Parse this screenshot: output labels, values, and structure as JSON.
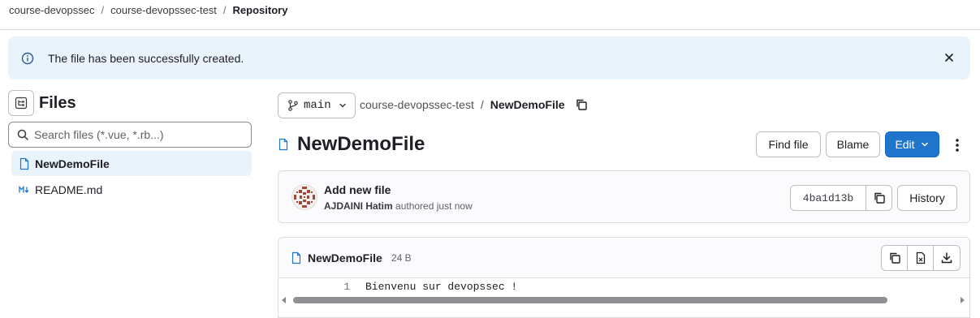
{
  "breadcrumb": {
    "items": [
      "course-devopssec",
      "course-devopssec-test"
    ],
    "current": "Repository",
    "separator": "/"
  },
  "alert": {
    "message": "The file has been successfully created.",
    "icon": "info-icon",
    "color": "#e9f3fc"
  },
  "sidebar": {
    "title": "Files",
    "search_placeholder": "Search files (*.vue, *.rb...)",
    "items": [
      {
        "label": "NewDemoFile",
        "icon": "file-icon",
        "active": true
      },
      {
        "label": "README.md",
        "icon": "markdown-icon",
        "active": false
      }
    ]
  },
  "branch": {
    "name": "main"
  },
  "path": {
    "project": "course-devopssec-test",
    "separator": "/",
    "file": "NewDemoFile"
  },
  "file": {
    "title": "NewDemoFile"
  },
  "actions": {
    "find_file": "Find file",
    "blame": "Blame",
    "edit": "Edit",
    "primary_color": "#1f75cb"
  },
  "commit": {
    "title": "Add new file",
    "author": "AJDAINI Hatim",
    "meta": "authored just now",
    "sha": "4ba1d13b",
    "history": "History"
  },
  "viewer": {
    "filename": "NewDemoFile",
    "size": "24 B",
    "lines": [
      {
        "number": "1",
        "text": "Bienvenu sur devopssec !"
      }
    ]
  }
}
